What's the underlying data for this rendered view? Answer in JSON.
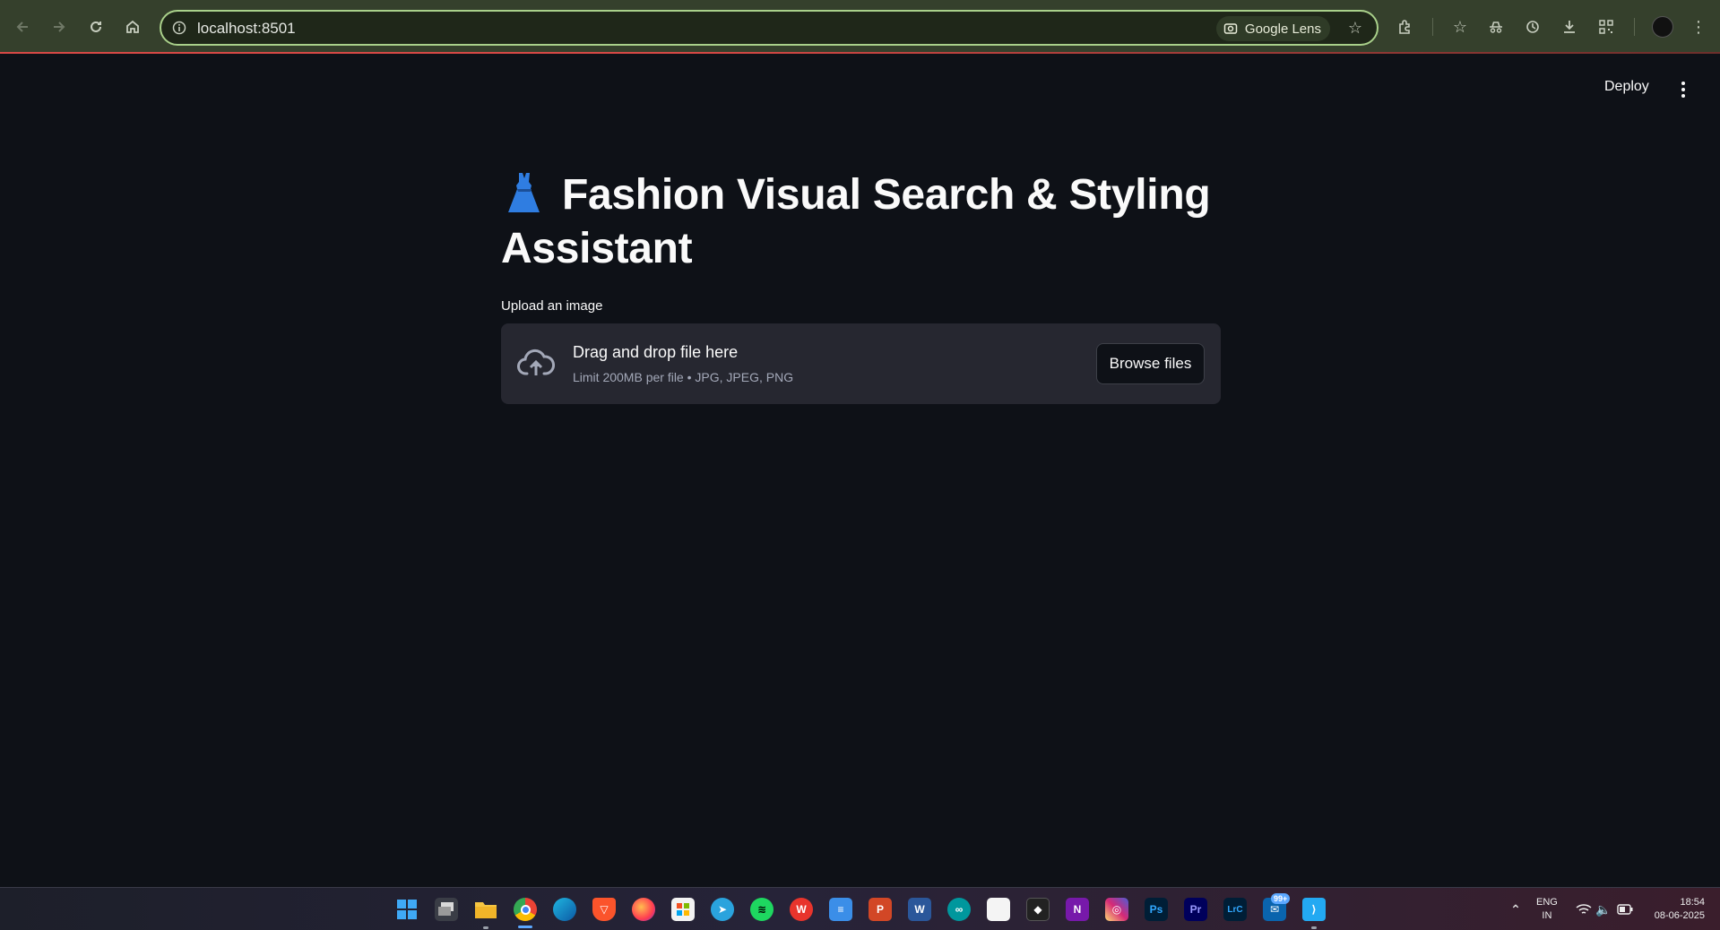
{
  "browser": {
    "url": "localhost:8501",
    "lens_label": "Google Lens",
    "toolbar_icons": [
      "back-icon",
      "forward-icon",
      "reload-icon",
      "home-icon",
      "extensions-icon",
      "bookmarks-icon",
      "incognito-icon",
      "history-icon",
      "download-icon",
      "qr-icon",
      "profile-icon"
    ]
  },
  "app_header": {
    "deploy_label": "Deploy"
  },
  "main": {
    "title": "Fashion Visual Search & Styling Assistant",
    "title_emoji": "dress",
    "upload_label": "Upload an image",
    "dropzone_title": "Drag and drop file here",
    "dropzone_subtitle": "Limit 200MB per file • JPG, JPEG, PNG",
    "browse_label": "Browse files"
  },
  "taskbar": {
    "apps": [
      "start",
      "task-view",
      "file-explorer",
      "chrome",
      "edge",
      "brave",
      "firefox",
      "microsoft-store",
      "telegram",
      "spotify",
      "wps-office",
      "notepad",
      "powerpoint",
      "word",
      "arduino",
      "file",
      "davinci-resolve",
      "onenote",
      "instagram",
      "photoshop",
      "premiere-pro",
      "lightroom-classic",
      "outlook",
      "vscode"
    ],
    "badge": "99+",
    "language": "ENG",
    "region": "IN",
    "time": "18:54",
    "date": "08-06-2025"
  },
  "colors": {
    "background": "#0e1117",
    "dropzone": "#262730",
    "chrome_bar": "#35402c",
    "omnibox_border": "#a9d08a",
    "accent_red": "#ff4b4b"
  }
}
